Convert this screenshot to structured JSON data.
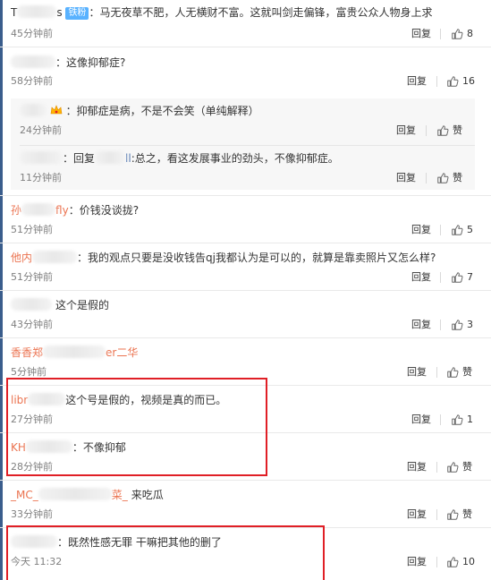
{
  "comments": [
    {
      "name_prefix": "T",
      "name_suffix": "s",
      "badge": "铁粉",
      "text": "马无夜草不肥，人无横财不富。这就叫剑走偏锋，富贵公众人物身上求",
      "time": "45分钟前",
      "reply": "回复",
      "likes": "8"
    },
    {
      "name_prefix": "",
      "name_suffix": "",
      "text": "：这像抑郁症?",
      "time": "58分钟前",
      "reply": "回复",
      "likes": "16",
      "replies": [
        {
          "name_prefix": "",
          "text": "抑郁症是病，不是不会笑（单纯解释）",
          "time": "24分钟前",
          "reply": "回复",
          "likes": "赞"
        },
        {
          "name_prefix": "",
          "reply_to_prefix": "回复",
          "reply_to_suffix": "ll",
          "text": ":总之，看这发展事业的劲头，不像抑郁症。",
          "time": "11分钟前",
          "reply": "回复",
          "likes": "赞"
        }
      ]
    },
    {
      "name_prefix": "孙",
      "name_suffix": "fly",
      "text": "：价钱没谈拢?",
      "time": "51分钟前",
      "reply": "回复",
      "likes": "5"
    },
    {
      "name_prefix": "他内",
      "name_suffix": "",
      "text": "：我的观点只要是没收钱告qj我都认为是可以的，就算是靠卖照片又怎么样?",
      "time": "51分钟前",
      "reply": "回复",
      "likes": "7"
    },
    {
      "name_prefix": "",
      "name_suffix": "",
      "text": "这个是假的",
      "time": "43分钟前",
      "reply": "回复",
      "likes": "3"
    },
    {
      "name_prefix": "香香郑",
      "name_suffix": "er二华",
      "text": "",
      "time": "5分钟前",
      "reply": "回复",
      "likes": "赞"
    },
    {
      "name_prefix": "libr",
      "name_suffix": "",
      "text": "这个号是假的，视频是真的而已。",
      "time": "27分钟前",
      "reply": "回复",
      "likes": "1"
    },
    {
      "name_prefix": "KH",
      "name_suffix": "",
      "text": "：不像抑郁",
      "time": "28分钟前",
      "reply": "回复",
      "likes": "赞"
    },
    {
      "name_prefix": "_MC_",
      "name_suffix": "菜_",
      "text": "来吃瓜",
      "time": "33分钟前",
      "reply": "回复",
      "likes": "赞"
    },
    {
      "name_prefix": "",
      "name_suffix": "",
      "text": "：既然性感无罪 干嘛把其他的删了",
      "time": "今天 11:32",
      "reply": "回复",
      "likes": "10"
    }
  ],
  "colors": {
    "name": "#eb7350",
    "highlight_box": "#e01f26",
    "nested_bg": "#f7f7f7",
    "iron_badge": "#59b2ff"
  },
  "icons": {
    "like": "thumbs-up-icon",
    "vip": "vip-crown-icon"
  }
}
